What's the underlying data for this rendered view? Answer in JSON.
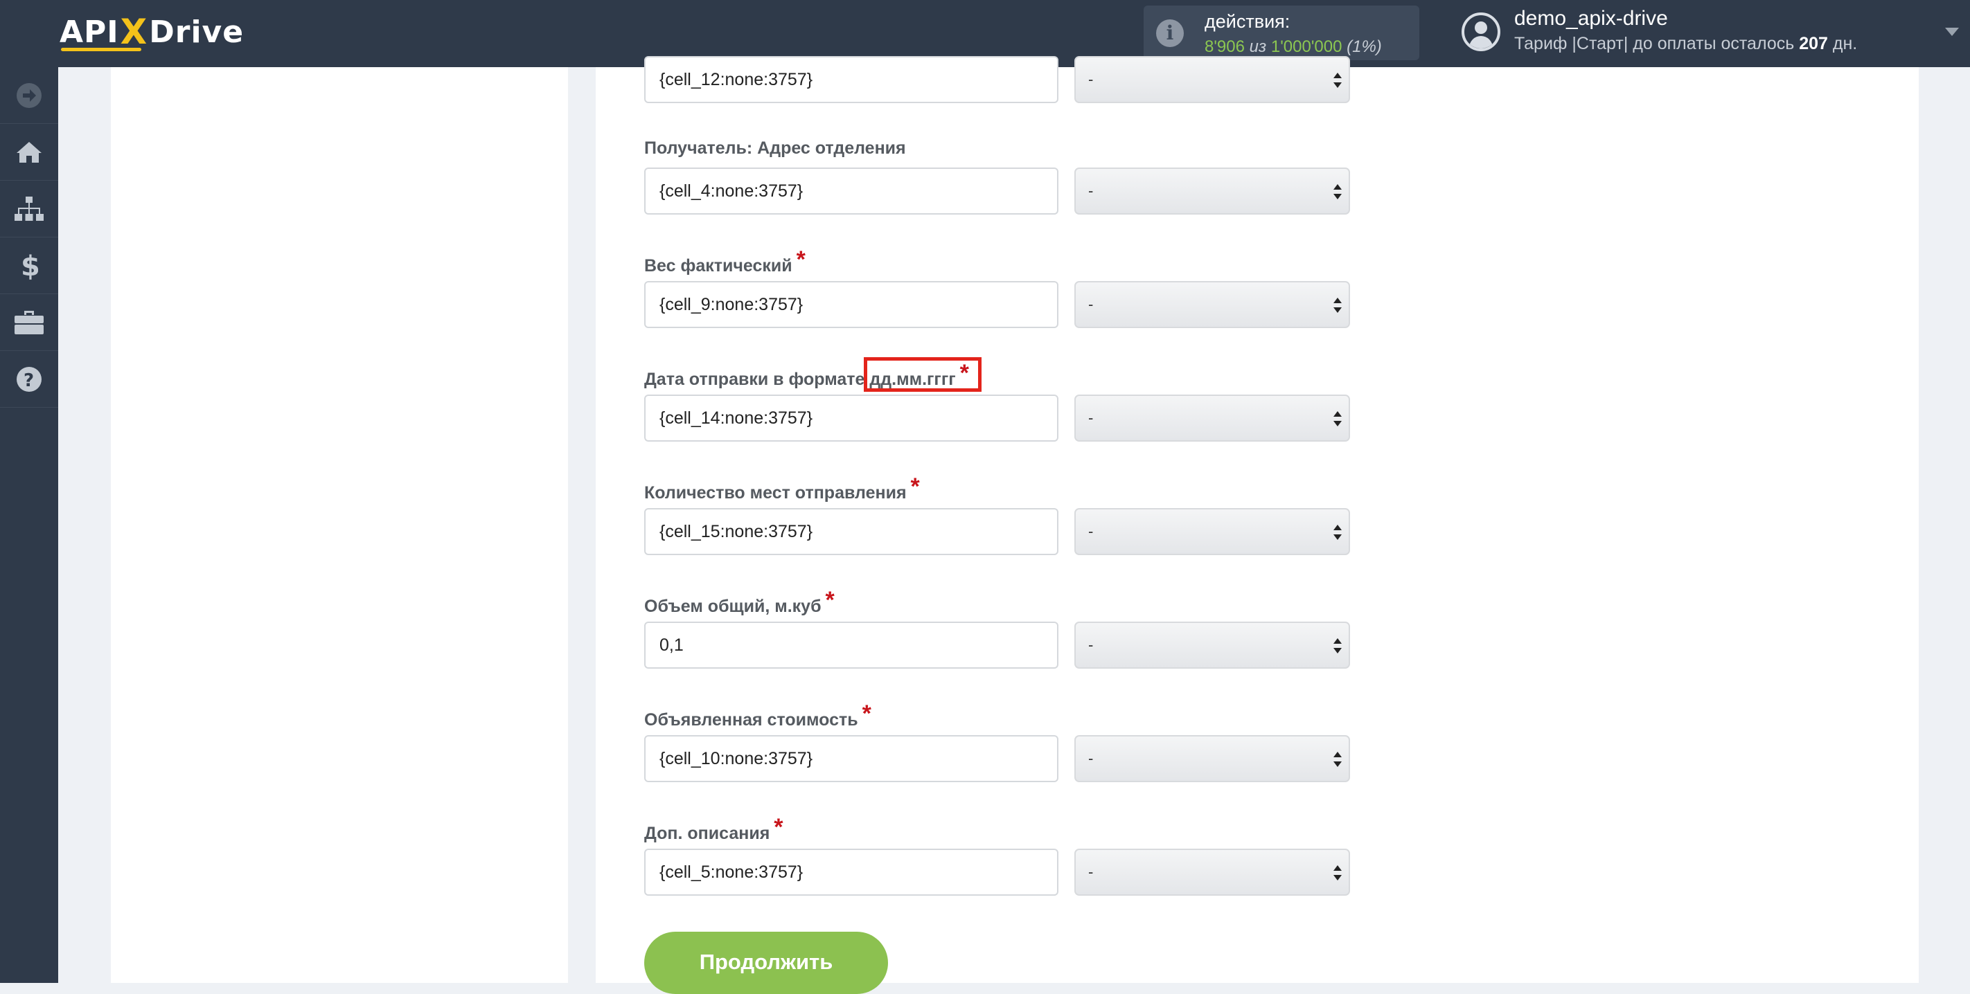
{
  "header": {
    "logo": {
      "left": "API",
      "x": "X",
      "right": "Drive"
    },
    "actions": {
      "label": "действия:",
      "used": "8'906",
      "of": "из",
      "total": "1'000'000",
      "percent": "(1%)"
    },
    "user": {
      "name": "demo_apix-drive",
      "tariff_text": "Тариф |Старт| до оплаты осталось",
      "days": "207",
      "days_unit": "дн."
    }
  },
  "sidebar": {
    "items": [
      {
        "icon": "arrow-right-circle-icon"
      },
      {
        "icon": "home-icon"
      },
      {
        "icon": "sitemap-icon"
      },
      {
        "icon": "dollar-icon"
      },
      {
        "icon": "briefcase-icon"
      },
      {
        "icon": "help-icon"
      }
    ]
  },
  "form": {
    "fields": [
      {
        "label": "",
        "required": false,
        "value": "{cell_12:none:3757}",
        "select": "-"
      },
      {
        "label": "Получатель: Адрес отделения",
        "required": false,
        "value": "{cell_4:none:3757}",
        "select": "-"
      },
      {
        "label": "Вес фактический",
        "required": true,
        "value": "{cell_9:none:3757}",
        "select": "-"
      },
      {
        "label": "Дата отправки в формате дд.мм.гггг",
        "required": true,
        "value": "{cell_14:none:3757}",
        "select": "-"
      },
      {
        "label": "Количество мест отправления",
        "required": true,
        "value": "{cell_15:none:3757}",
        "select": "-"
      },
      {
        "label": "Объем общий, м.куб",
        "required": true,
        "value": "0,1",
        "select": "-"
      },
      {
        "label": "Объявленная стоимость",
        "required": true,
        "value": "{cell_10:none:3757}",
        "select": "-"
      },
      {
        "label": "Доп. описания",
        "required": true,
        "value": "{cell_5:none:3757}",
        "select": "-"
      }
    ],
    "required_mark": "*",
    "continue_label": "Продолжить"
  }
}
